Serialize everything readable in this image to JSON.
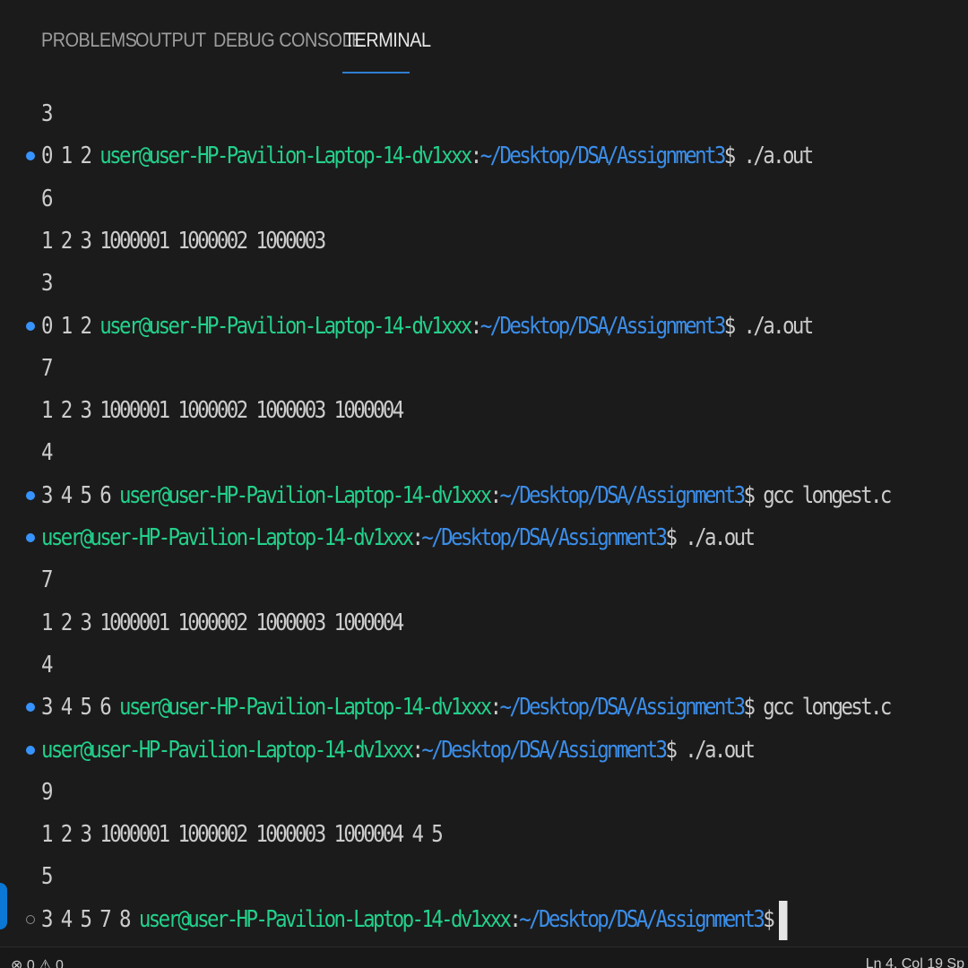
{
  "tabs": [
    {
      "label": "PROBLEMS",
      "active": false
    },
    {
      "label": "OUTPUT",
      "active": false
    },
    {
      "label": "DEBUG CONSOLE",
      "active": false
    },
    {
      "label": "TERMINAL",
      "active": true
    }
  ],
  "terminal": {
    "lines": [
      {
        "text": "3"
      },
      {
        "pre": "0 1 2 ",
        "user": "user@user-HP-Pavilion-Laptop-14-dv1xxx",
        "sep": ":",
        "path": "~/Desktop/DSA/Assignment3",
        "cmd": "$ ./a.out"
      },
      {
        "text": "6"
      },
      {
        "text": "1 2 3 1000001 1000002 1000003"
      },
      {
        "text": "3"
      },
      {
        "pre": "0 1 2 ",
        "user": "user@user-HP-Pavilion-Laptop-14-dv1xxx",
        "sep": ":",
        "path": "~/Desktop/DSA/Assignment3",
        "cmd": "$ ./a.out"
      },
      {
        "text": "7"
      },
      {
        "text": "1 2 3 1000001 1000002 1000003 1000004"
      },
      {
        "text": "4"
      },
      {
        "pre": "3 4 5 6 ",
        "user": "user@user-HP-Pavilion-Laptop-14-dv1xxx",
        "sep": ":",
        "path": "~/Desktop/DSA/Assignment3",
        "cmd": "$ gcc longest.c"
      },
      {
        "pre": "",
        "user": "user@user-HP-Pavilion-Laptop-14-dv1xxx",
        "sep": ":",
        "path": "~/Desktop/DSA/Assignment3",
        "cmd": "$ ./a.out"
      },
      {
        "text": "7"
      },
      {
        "text": "1 2 3 1000001 1000002 1000003 1000004"
      },
      {
        "text": "4"
      },
      {
        "pre": "3 4 5 6 ",
        "user": "user@user-HP-Pavilion-Laptop-14-dv1xxx",
        "sep": ":",
        "path": "~/Desktop/DSA/Assignment3",
        "cmd": "$ gcc longest.c"
      },
      {
        "pre": "",
        "user": "user@user-HP-Pavilion-Laptop-14-dv1xxx",
        "sep": ":",
        "path": "~/Desktop/DSA/Assignment3",
        "cmd": "$ ./a.out"
      },
      {
        "text": "9"
      },
      {
        "text": "1 2 3 1000001 1000002 1000003 1000004 4 5"
      },
      {
        "text": "5"
      },
      {
        "pre": "3 4 5 7 8 ",
        "user": "user@user-HP-Pavilion-Laptop-14-dv1xxx",
        "sep": ":",
        "path": "~/Desktop/DSA/Assignment3",
        "cmd": "$"
      }
    ]
  },
  "status_bar": {
    "left": "⊗ 0 ⚠ 0",
    "right": "Ln 4, Col 19   Sp"
  },
  "colors": {
    "background": "#1b1b1b",
    "user": "#23d18b",
    "path": "#3b8eea",
    "text": "#cccccc",
    "accent": "#2f7fd0"
  }
}
